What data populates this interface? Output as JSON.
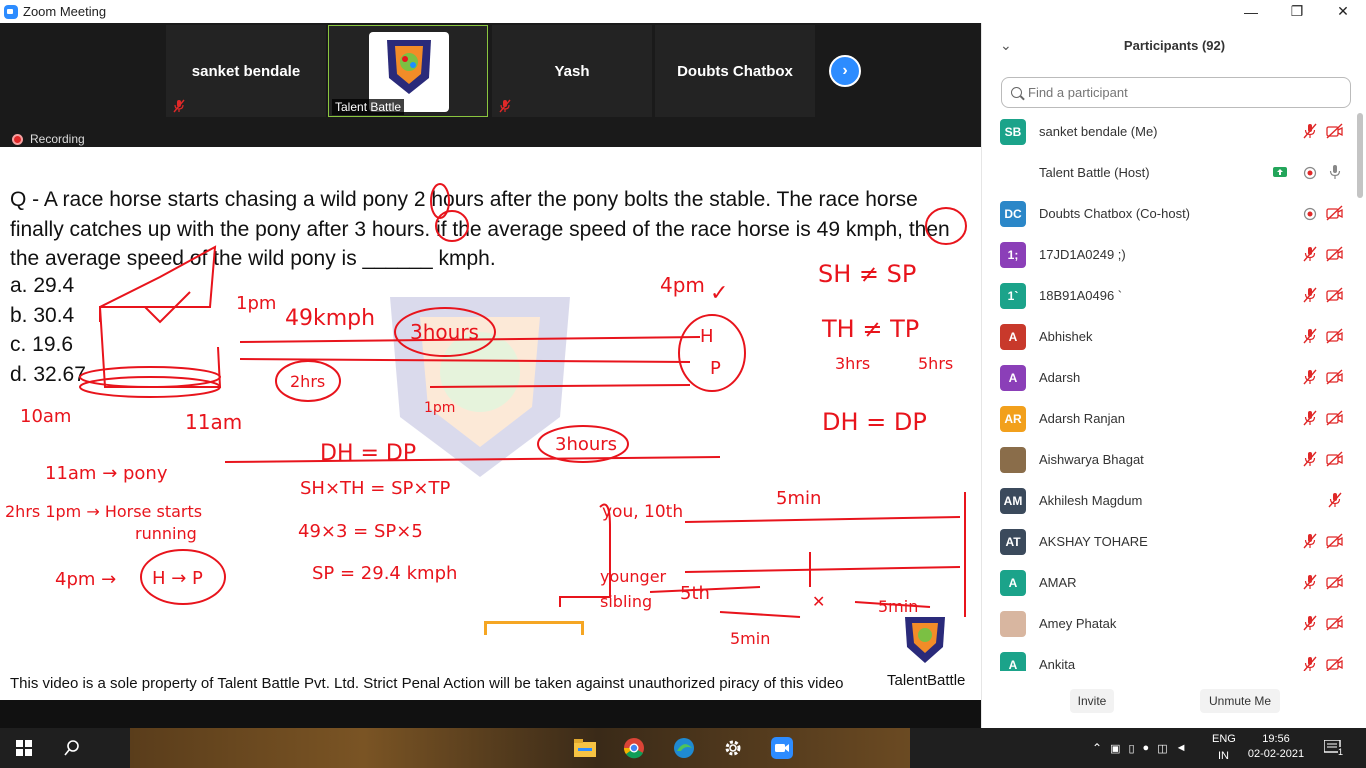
{
  "window": {
    "title": "Zoom Meeting",
    "minimize": "—",
    "maximize": "❐",
    "close": "✕"
  },
  "meeting": {
    "tiles": [
      {
        "name": "sanket bendale"
      },
      {
        "name": "Talent Battle"
      },
      {
        "name": "Yash"
      },
      {
        "name": "Doubts Chatbox"
      }
    ],
    "next_label": "›",
    "recording_label": "Recording"
  },
  "share": {
    "question": "Q - A race horse starts chasing a wild pony 2 hours after the pony bolts the stable. The race horse finally catches up with the pony after 3 hours. if the average speed of the race horse is 49 kmph, then the average speed of the wild pony is ______ kmph.",
    "options": [
      "a. 29.4",
      "b. 30.4",
      "c. 19.6",
      "d. 32.67"
    ],
    "footer": "This video is a sole property of Talent Battle Pvt. Ltd. Strict Penal Action will be taken against unauthorized piracy of this video",
    "brand": "TalentBattle",
    "annotations": {
      "t1pm": "1pm",
      "speed": "49kmph",
      "hours3a": "3hours",
      "t4pm": "4pm",
      "checkmark": "✓",
      "hrs2": "2hrs",
      "t10am": "10am",
      "t11am": "11am",
      "t1pm_b": "1pm",
      "H": "H",
      "P": "P",
      "dh_dp": "DH = DP",
      "hours3b": "3hours",
      "sh_ne_sp": "SH ≠ SP",
      "th_ne_tp": "TH ≠ TP",
      "t3hrs": "3hrs",
      "t5hrs": "5hrs",
      "dh_eq_dp": "DH = DP",
      "l1": "11am → pony",
      "l2": "2hrs 1pm → Horse starts",
      "l3": "running",
      "l4": "4pm →",
      "l5": "H → P",
      "eq1": "SH×TH = SP×TP",
      "eq2": "49×3 = SP×5",
      "eq3": "SP = 29.4 kmph",
      "you": "you, 10th",
      "younger": "younger",
      "sibling": "sibling",
      "fifth": "5th",
      "m5a": "5min",
      "m5b": "5min",
      "m5c": "5min",
      "x": "✕"
    }
  },
  "panel": {
    "title": "Participants (92)",
    "search_placeholder": "Find a participant",
    "participants": [
      {
        "initials": "SB",
        "name": "sanket bendale (Me)",
        "color": "#1ba38a"
      },
      {
        "initials": "",
        "name": "Talent Battle (Host)",
        "color": "#ffffff"
      },
      {
        "initials": "DC",
        "name": "Doubts Chatbox (Co-host)",
        "color": "#2b87c8"
      },
      {
        "initials": "1;",
        "name": "17JD1A0249 ;)",
        "color": "#8b3fb8"
      },
      {
        "initials": "1`",
        "name": "18B91A0496 `",
        "color": "#1ba38a"
      },
      {
        "initials": "A",
        "name": "Abhishek",
        "color": "#c8392b"
      },
      {
        "initials": "A",
        "name": "Adarsh",
        "color": "#8b3fb8"
      },
      {
        "initials": "AR",
        "name": "Adarsh Ranjan",
        "color": "#f2a01c"
      },
      {
        "initials": "",
        "name": "Aishwarya Bhagat",
        "color": "#8a6d4a"
      },
      {
        "initials": "AM",
        "name": "Akhilesh Magdum",
        "color": "#3b4a5c"
      },
      {
        "initials": "AT",
        "name": "AKSHAY TOHARE",
        "color": "#3b4a5c"
      },
      {
        "initials": "A",
        "name": "AMAR",
        "color": "#1ba38a"
      },
      {
        "initials": "",
        "name": "Amey Phatak",
        "color": "#d8b6a0"
      },
      {
        "initials": "A",
        "name": "Ankita",
        "color": "#1ba38a"
      }
    ],
    "invite_label": "Invite",
    "unmute_label": "Unmute Me"
  },
  "taskbar": {
    "lang_top": "ENG",
    "lang_bottom": "IN",
    "time": "19:56",
    "date": "02-02-2021",
    "notif_count": "1"
  },
  "colors": {
    "accent": "#2d8cff",
    "annotation": "#e8141c",
    "mute_red": "#e02828"
  }
}
